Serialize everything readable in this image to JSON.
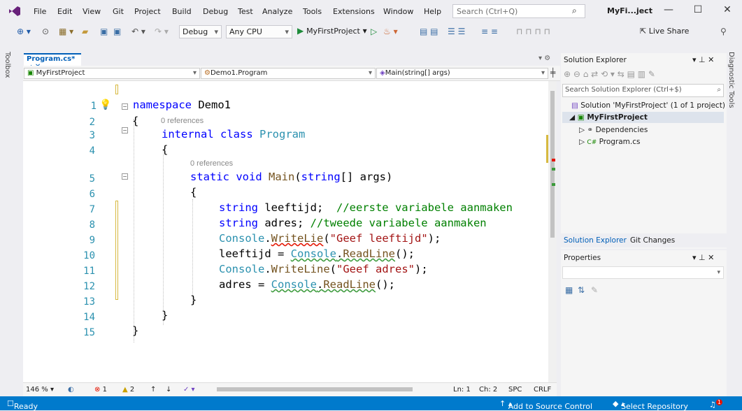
{
  "menu": {
    "file": "File",
    "edit": "Edit",
    "view": "View",
    "git": "Git",
    "project": "Project",
    "build": "Build",
    "debug": "Debug",
    "test": "Test",
    "analyze": "Analyze",
    "tools": "Tools",
    "extensions": "Extensions",
    "window": "Window",
    "help": "Help"
  },
  "search": {
    "placeholder": "Search (Ctrl+Q)"
  },
  "title": {
    "project": "MyFi...ject"
  },
  "toolbar": {
    "config": "Debug",
    "platform": "Any CPU",
    "run": "MyFirstProject",
    "live_share": "Live Share"
  },
  "side": {
    "toolbox": "Toolbox",
    "diagnostic": "Diagnostic Tools"
  },
  "editor": {
    "tab": "Program.cs*",
    "nav_project": "MyFirstProject",
    "nav_class": "Demo1.Program",
    "nav_member": "Main(string[] args)",
    "references": "0 references"
  },
  "code": {
    "lines": [
      "1",
      "2",
      "3",
      "4",
      "5",
      "6",
      "7",
      "8",
      "9",
      "10",
      "11",
      "12",
      "13",
      "14",
      "15"
    ],
    "l1_kw": "namespace",
    "l1_name": " Demo1",
    "brace_open": "{",
    "brace_close": "}",
    "l3_kw": "internal class",
    "l3_type": " Program",
    "l5_kw": "static void",
    "l5_name": " Main",
    "l5_p1": "(",
    "l5_kw2": "string",
    "l5_p2": "[] args)",
    "l7_kw": "string",
    "l7_var": " leeftijd;  ",
    "l7_cm": "//eerste variabele aanmaken",
    "l8_kw": "string",
    "l8_var": " adres; ",
    "l8_cm": "//tweede variabele aanmaken",
    "l9_type": "Console",
    "l9_dot": ".",
    "l9_m": "WriteLie",
    "l9_p": "(",
    "l9_s": "\"Geef leeftijd\"",
    "l9_e": ");",
    "l10_var": "leeftijd = ",
    "l10_type": "Console",
    "l10_dot": ".",
    "l10_m": "ReadLine",
    "l10_e": "();",
    "l11_type": "Console",
    "l11_dot": ".",
    "l11_m": "WriteLine",
    "l11_p": "(",
    "l11_s": "\"Geef adres\"",
    "l11_e": ");",
    "l12_var": "adres = ",
    "l12_type": "Console",
    "l12_dot": ".",
    "l12_m": "ReadLine",
    "l12_e": "();"
  },
  "editor_status": {
    "zoom": "146 %",
    "errors": "1",
    "warnings": "2",
    "ln": "Ln: 1",
    "ch": "Ch: 2",
    "spc": "SPC",
    "crlf": "CRLF"
  },
  "solution": {
    "title": "Solution Explorer",
    "search": "Search Solution Explorer (Ctrl+$)",
    "solution": "Solution 'MyFirstProject' (1 of 1 project)",
    "project": "MyFirstProject",
    "dependencies": "Dependencies",
    "program": "Program.cs",
    "tab1": "Solution Explorer",
    "tab2": "Git Changes"
  },
  "properties": {
    "title": "Properties"
  },
  "statusbar": {
    "ready": "Ready",
    "add_source": "Add to Source Control",
    "select_repo": "Select Repository",
    "notifications": "1"
  },
  "colors": {
    "accent": "#007acc",
    "keyword": "#0000ff",
    "type": "#2b91af",
    "string": "#a31515",
    "comment": "#008000"
  }
}
